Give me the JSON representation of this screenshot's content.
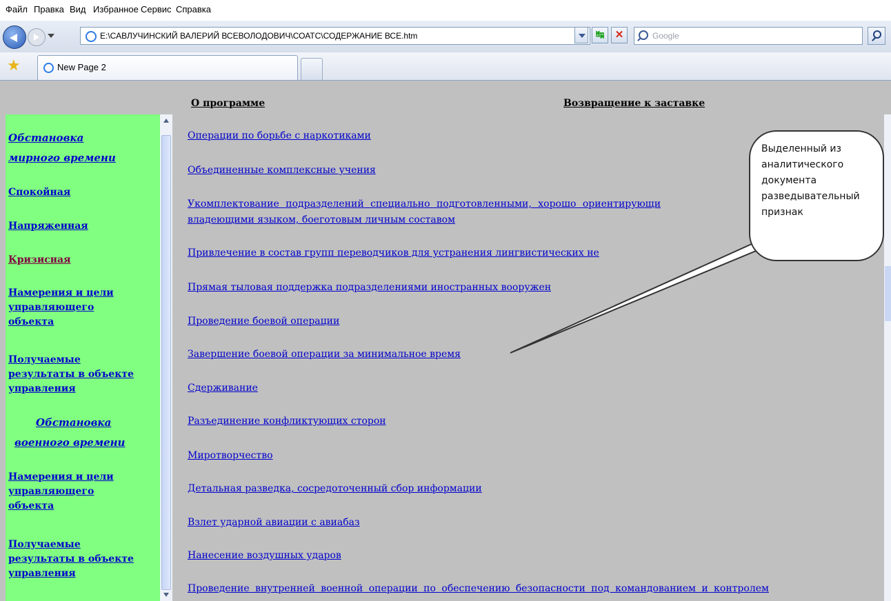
{
  "browser": {
    "menu": [
      "Файл",
      "Правка",
      "Вид",
      "Избранное",
      "Сервис",
      "Справка"
    ],
    "address": "E:\\САВЛУЧИНСКИЙ ВАЛЕРИЙ ВСЕВОЛОДОВИЧ\\СОАТС\\СОДЕРЖАНИЕ ВСЕ.htm",
    "search_placeholder": "Google",
    "tab_title": "New Page 2"
  },
  "page": {
    "top_links": {
      "about": "О программе",
      "back_to_splash": "Возвращение к заставке"
    },
    "sidebar": {
      "peacetime_heading_1": "Обстановка",
      "peacetime_heading_2": "мирного времени",
      "calm": "Спокойная",
      "tense": "Напряженная",
      "crisis": "Кризисная",
      "peace_intentions": [
        "Намерения и цели",
        "управляющего",
        "объекта"
      ],
      "peace_results": [
        "Получаемые",
        "результаты в объекте",
        "управления"
      ],
      "wartime_heading_1": "Обстановка",
      "wartime_heading_2": "военного времени",
      "war_intentions": [
        "Намерения и цели",
        "управляющего",
        "объекта"
      ],
      "war_results": [
        "Получаемые",
        "результаты в объекте",
        "управления"
      ]
    },
    "main_links": [
      "Операции по борьбе с наркотиками",
      "Объединенные комплексные учения",
      "Укомплектование подразделений специально подготовленными, хорошо ориентирующи",
      "владеющими языком, боеготовым личным составом",
      "Привлечение в состав групп переводчиков для устранения лингвистических не",
      "Прямая тыловая поддержка подразделениями иностранных вооружен",
      "Проведение боевой операции",
      "Завершение боевой операции за минимальное время",
      "Сдерживание",
      "Разъединение конфликтующих сторон",
      "Миротворчество",
      "Детальная разведка, сосредоточенный сбор информации",
      "Взлет ударной авиации с авиабаз",
      "Нанесение воздушных ударов",
      "Проведение внутренней военной операции по обеспечению безопасности под командованием и контролем"
    ],
    "callout": "Выделенный из аналитического документа разведывательный признак"
  }
}
